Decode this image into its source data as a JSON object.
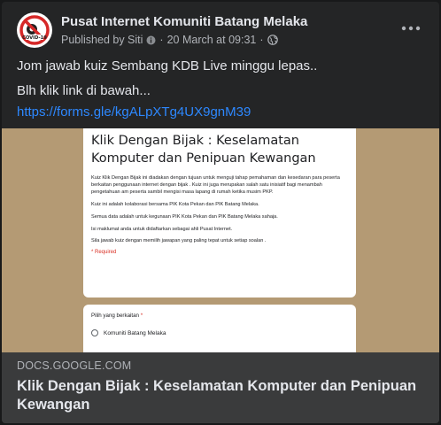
{
  "post": {
    "page_name": "Pusat Internet Komuniti Batang Melaka",
    "published_by": "Published by Siti",
    "timestamp": "20 March at 09:31",
    "separator": "·",
    "avatar_text": "COVID-19",
    "line1": "Jom jawab kuiz Sembang KDB Live minggu lepas..",
    "line2": "Blh klik link di bawah...",
    "link_url": "https://forms.gle/kgALpXTg4UX9gnM39"
  },
  "form_preview": {
    "title": "Klik Dengan Bijak : Keselamatan Komputer dan Penipuan Kewangan",
    "paragraphs": [
      "Kuiz Klik Dengan Bijak ini diadakan dengan tujuan untuk menguji tahap pemahaman dan kesedaran para peserta berkaitan penggunaan internet dengan bijak . Kuiz ini juga merupakan salah satu inisiatif bagi menambah pengetahuan am peserta sambil mengisi masa lapang di rumah ketika musim PKP.",
      "Kuiz ini adalah kolaborasi bersama PIK Kota Pekan dan PIK Batang Melaka.",
      "Semua data adalah untuk kegunaan PIK Kota Pekan dan PIK Batang Melaka sahaja.",
      "Isi maklumat anda untuk didaftarkan sebagai ahli Pusat Internet.",
      "Sila jawab kuiz dengan memilih jawapan yang paling tepat untuk setiap soalan ."
    ],
    "required": "* Required",
    "question": "Pilih yang berkaitan",
    "question_star": "*",
    "option1": "Komuniti Batang Melaka"
  },
  "link_card": {
    "domain": "DOCS.GOOGLE.COM",
    "title": "Klik Dengan Bijak : Keselamatan Komputer dan Penipuan Kewangan"
  },
  "colors": {
    "background": "#18191a",
    "card": "#242526",
    "footer": "#3a3b3c",
    "link": "#2d88ff",
    "preview_bg": "#b49a74",
    "required": "#d93025"
  },
  "icons": [
    "covid-ban-icon",
    "verified-info-icon",
    "globe-icon",
    "more-options-icon"
  ]
}
